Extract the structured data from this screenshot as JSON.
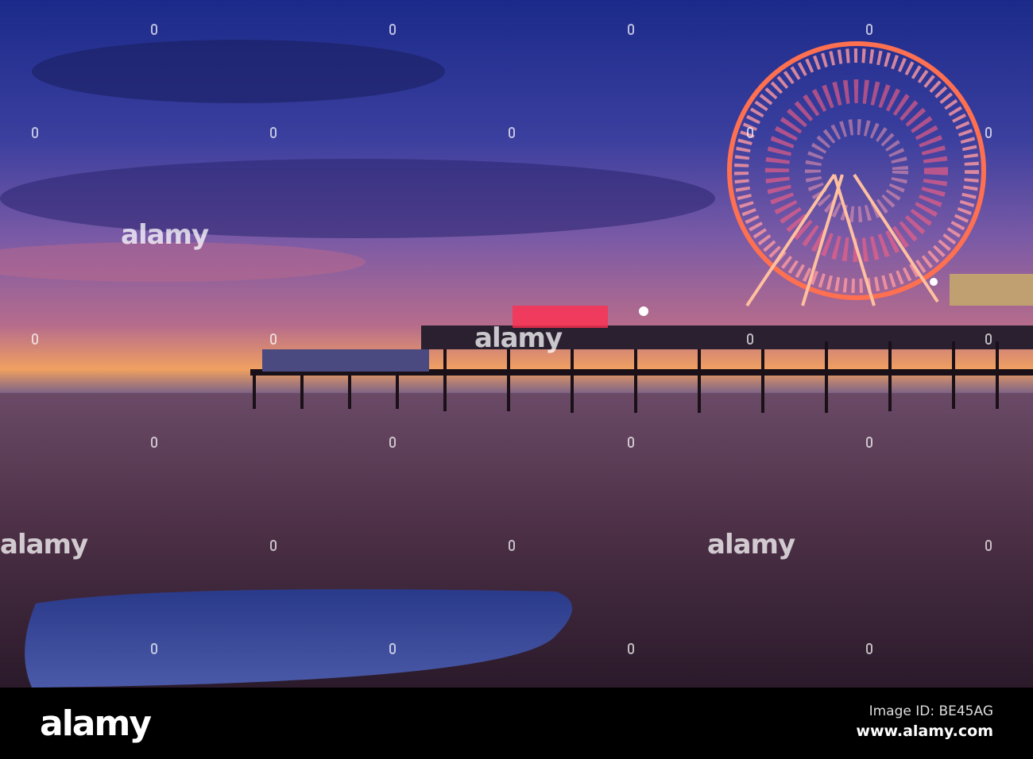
{
  "watermark": "alamy",
  "footer": {
    "logo": "alamy",
    "image_id": "Image ID: BE45AG",
    "website": "www.alamy.com"
  }
}
